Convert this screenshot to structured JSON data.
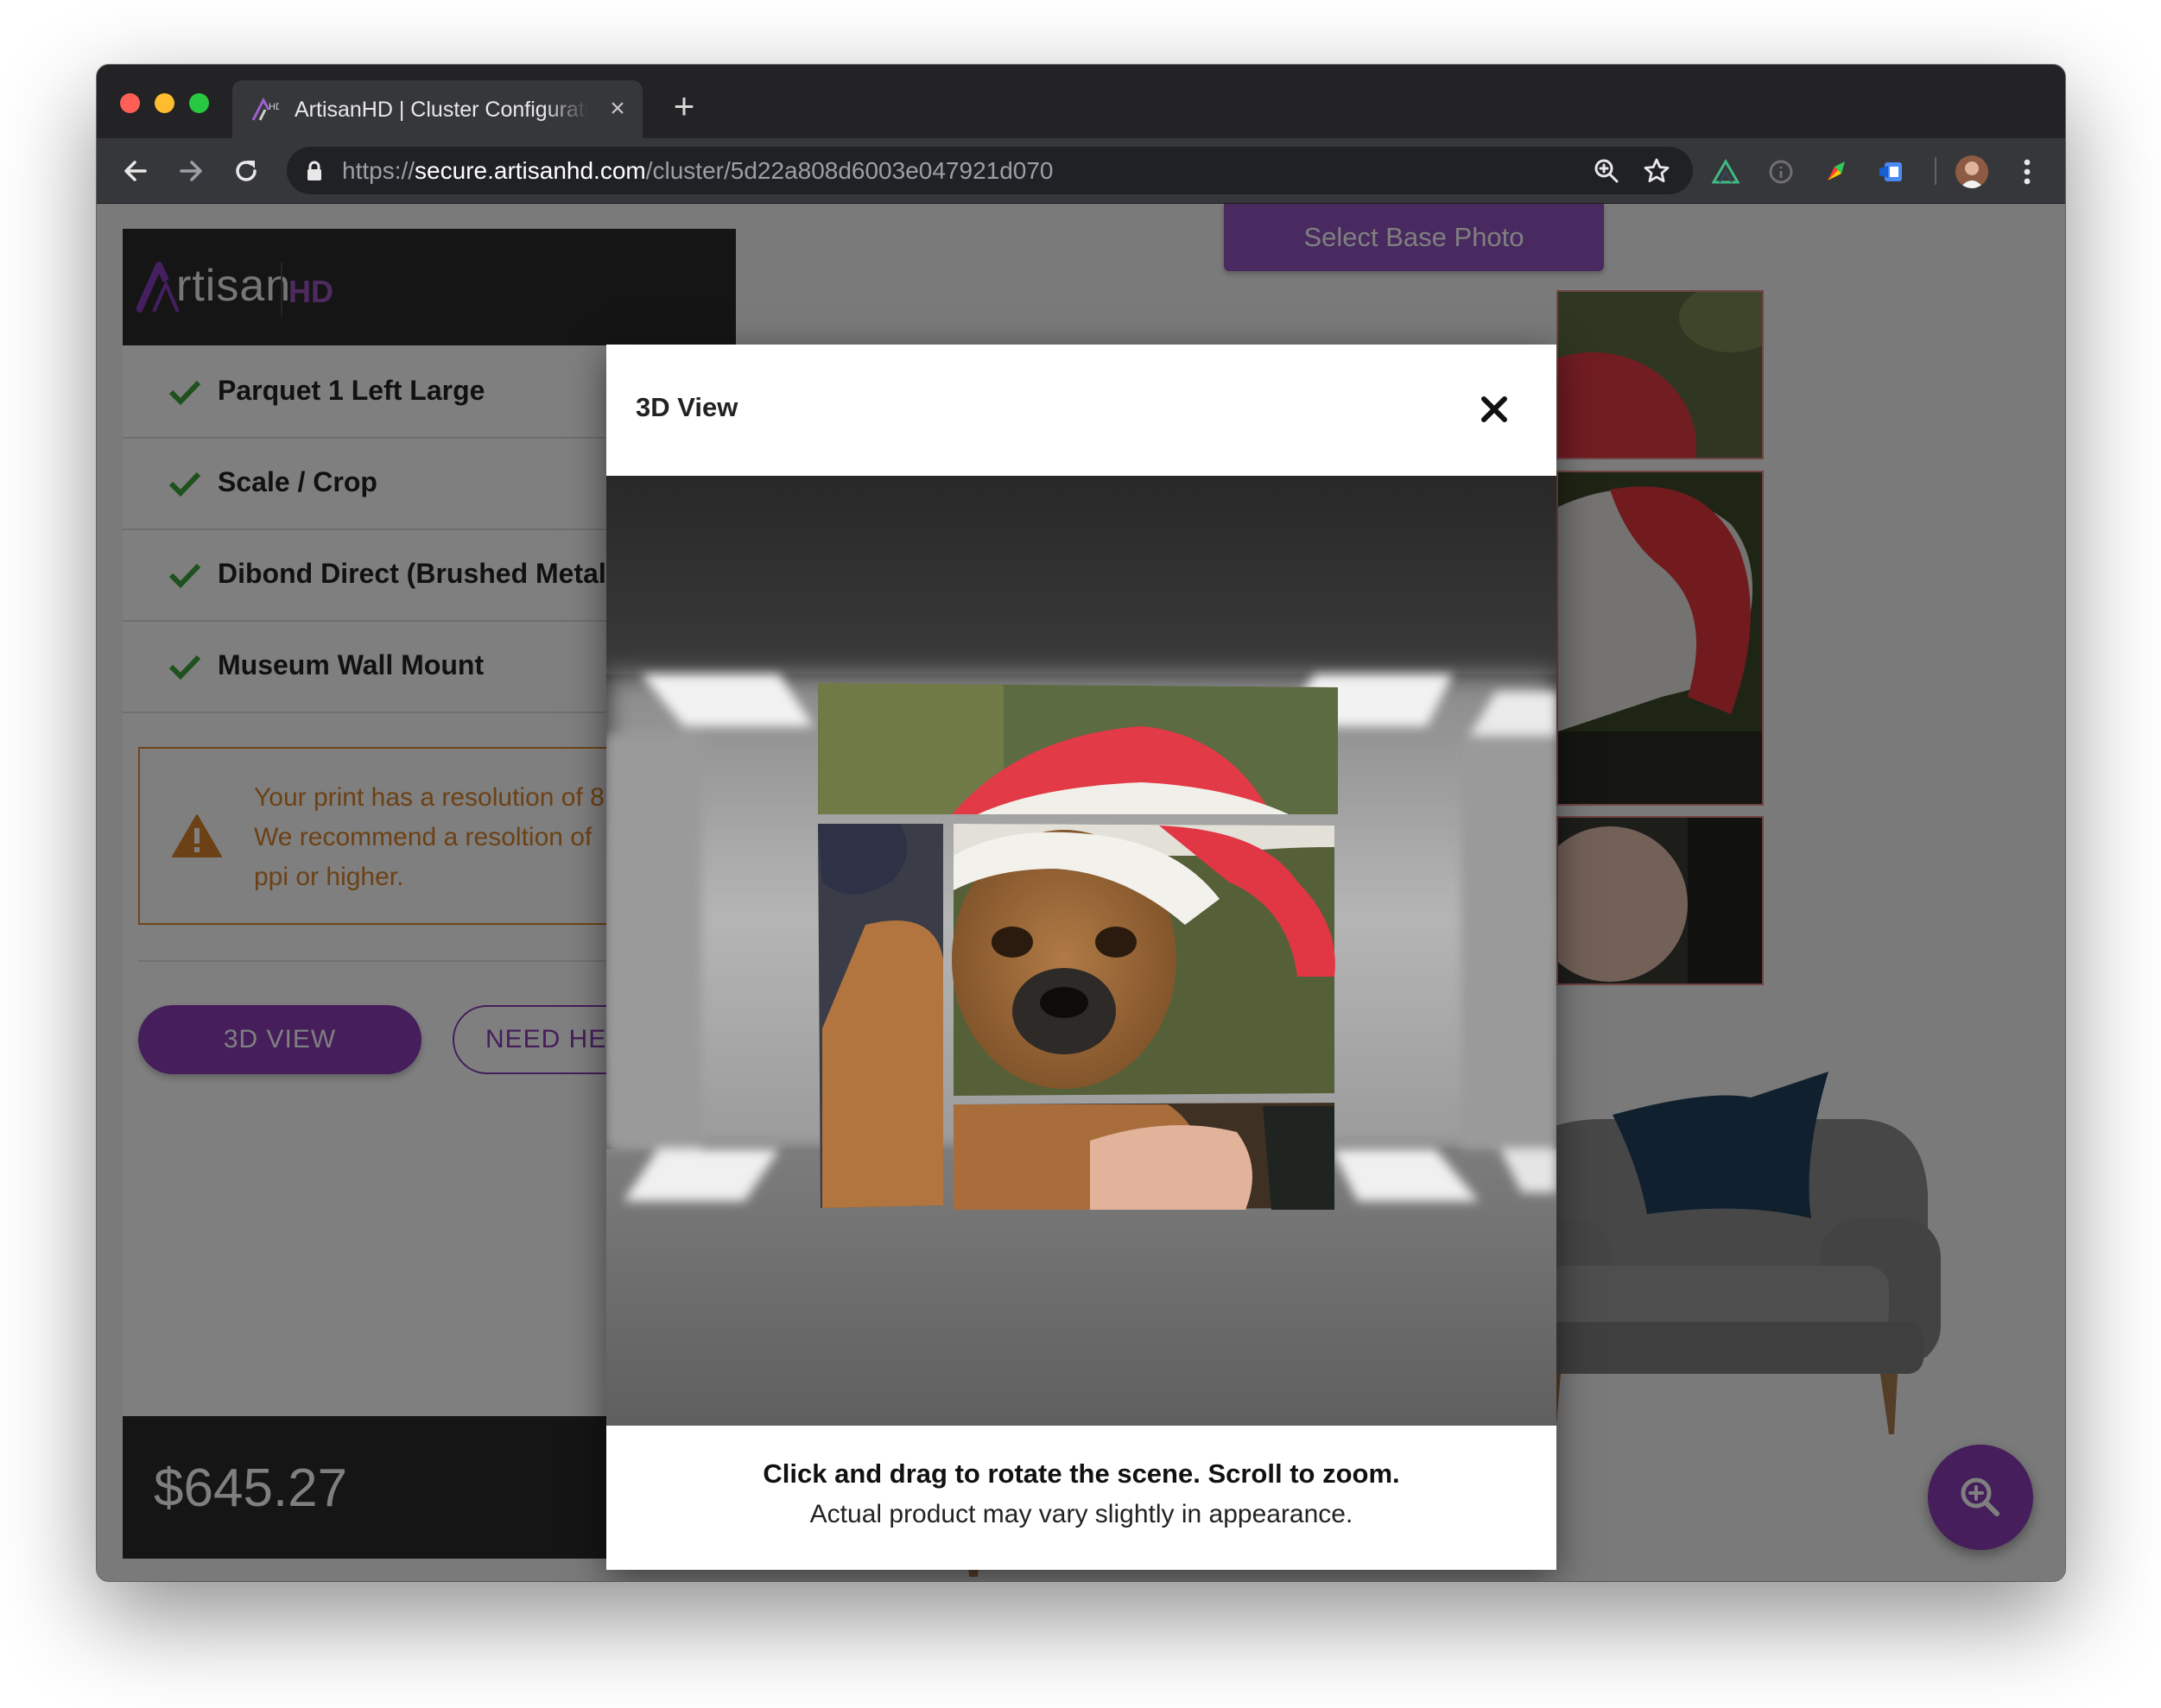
{
  "browser": {
    "tab_title": "ArtisanHD | Cluster Configurator",
    "tab_close": "×",
    "new_tab": "+",
    "url_scheme": "https://",
    "url_host": "secure.artisanhd.com",
    "url_path": "/cluster/5d22a808d6003e047921d070",
    "icons": [
      "back-arrow-icon",
      "forward-arrow-icon",
      "reload-icon",
      "lock-icon",
      "zoom-icon",
      "bookmark-star-icon",
      "extension-icon",
      "profile-avatar",
      "menu-dots-icon"
    ]
  },
  "sidebar": {
    "logo_text": "rtisan",
    "logo_hd": "HD",
    "steps": [
      {
        "label": "Parquet 1 Left Large"
      },
      {
        "label": "Scale / Crop"
      },
      {
        "label": "Dibond Direct (Brushed Metal)"
      },
      {
        "label": "Museum Wall Mount"
      }
    ],
    "warning_lines": [
      "Your print has a resolution of 8",
      "We recommend a resoltion of",
      "ppi or higher."
    ],
    "btn_3d": "3D VIEW",
    "btn_help": "NEED HELP?",
    "price": "$645.27"
  },
  "main": {
    "select_base_photo": "Select Base Photo"
  },
  "modal": {
    "title": "3D View",
    "footer_line1": "Click and drag to rotate the scene. Scroll to zoom.",
    "footer_line2": "Actual product may vary slightly in appearance."
  },
  "colors": {
    "brand_purple": "#8a3cb6",
    "warning_orange": "#d9822b",
    "success_green": "#3da23d",
    "dark_bar": "#2b2b2b"
  }
}
